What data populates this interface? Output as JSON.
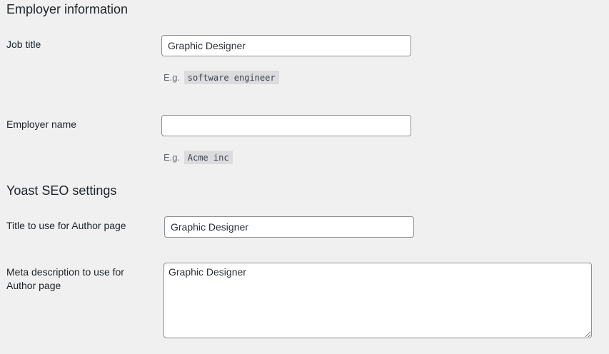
{
  "employer_section": {
    "heading": "Employer information",
    "job_title": {
      "label": "Job title",
      "value": "Graphic Designer",
      "hint_prefix": "E.g.",
      "hint_example": "software engineer"
    },
    "employer_name": {
      "label": "Employer name",
      "value": "",
      "hint_prefix": "E.g.",
      "hint_example": "Acme inc"
    }
  },
  "yoast_section": {
    "heading": "Yoast SEO settings",
    "author_title": {
      "label": "Title to use for Author page",
      "value": "Graphic Designer"
    },
    "meta_description": {
      "label": "Meta description to use for Author page",
      "value": "Graphic Designer"
    }
  }
}
